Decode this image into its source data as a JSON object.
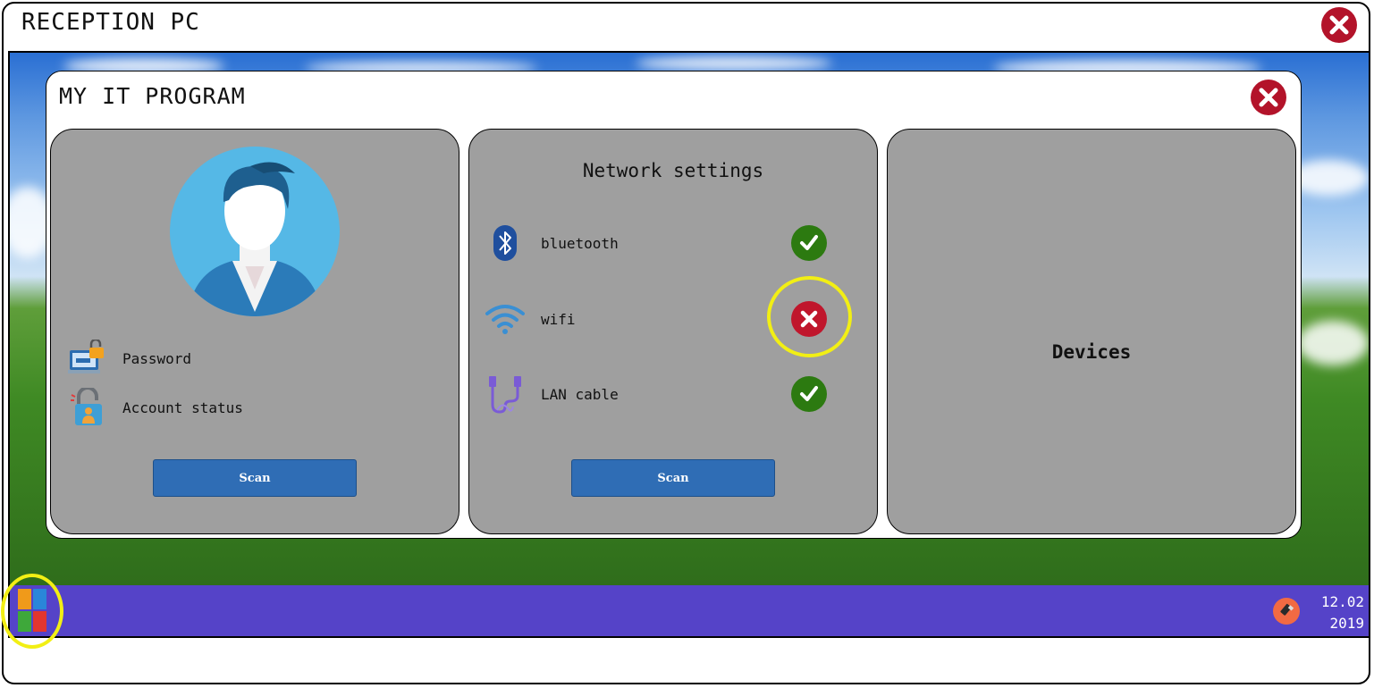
{
  "outer_window": {
    "title": "RECEPTION PC",
    "close_icon": "close-icon"
  },
  "app_window": {
    "title": "MY IT PROGRAM",
    "close_icon": "close-icon"
  },
  "account_panel": {
    "avatar_icon": "user-avatar-icon",
    "items": [
      {
        "label": "Password",
        "icon": "laptop-lock-icon"
      },
      {
        "label": "Account status",
        "icon": "user-lock-icon"
      }
    ],
    "scan_label": "Scan"
  },
  "network_panel": {
    "title": "Network settings",
    "items": [
      {
        "label": "bluetooth",
        "icon": "bluetooth-icon",
        "status": "ok"
      },
      {
        "label": "wifi",
        "icon": "wifi-icon",
        "status": "error"
      },
      {
        "label": "LAN cable",
        "icon": "lan-cable-icon",
        "status": "ok"
      }
    ],
    "scan_label": "Scan"
  },
  "devices_panel": {
    "title": "Devices"
  },
  "taskbar": {
    "start_icon": "start-menu-icon",
    "tray_icon": "usb-icon",
    "clock": {
      "line1": "12.02",
      "line2": "2019"
    }
  },
  "colors": {
    "taskbar": "#5543c8",
    "panel": "#9f9f9f",
    "scan_button": "#2f6db5",
    "status_ok": "#2c7a10",
    "status_error": "#c0162c",
    "highlight": "#f2ef14"
  }
}
